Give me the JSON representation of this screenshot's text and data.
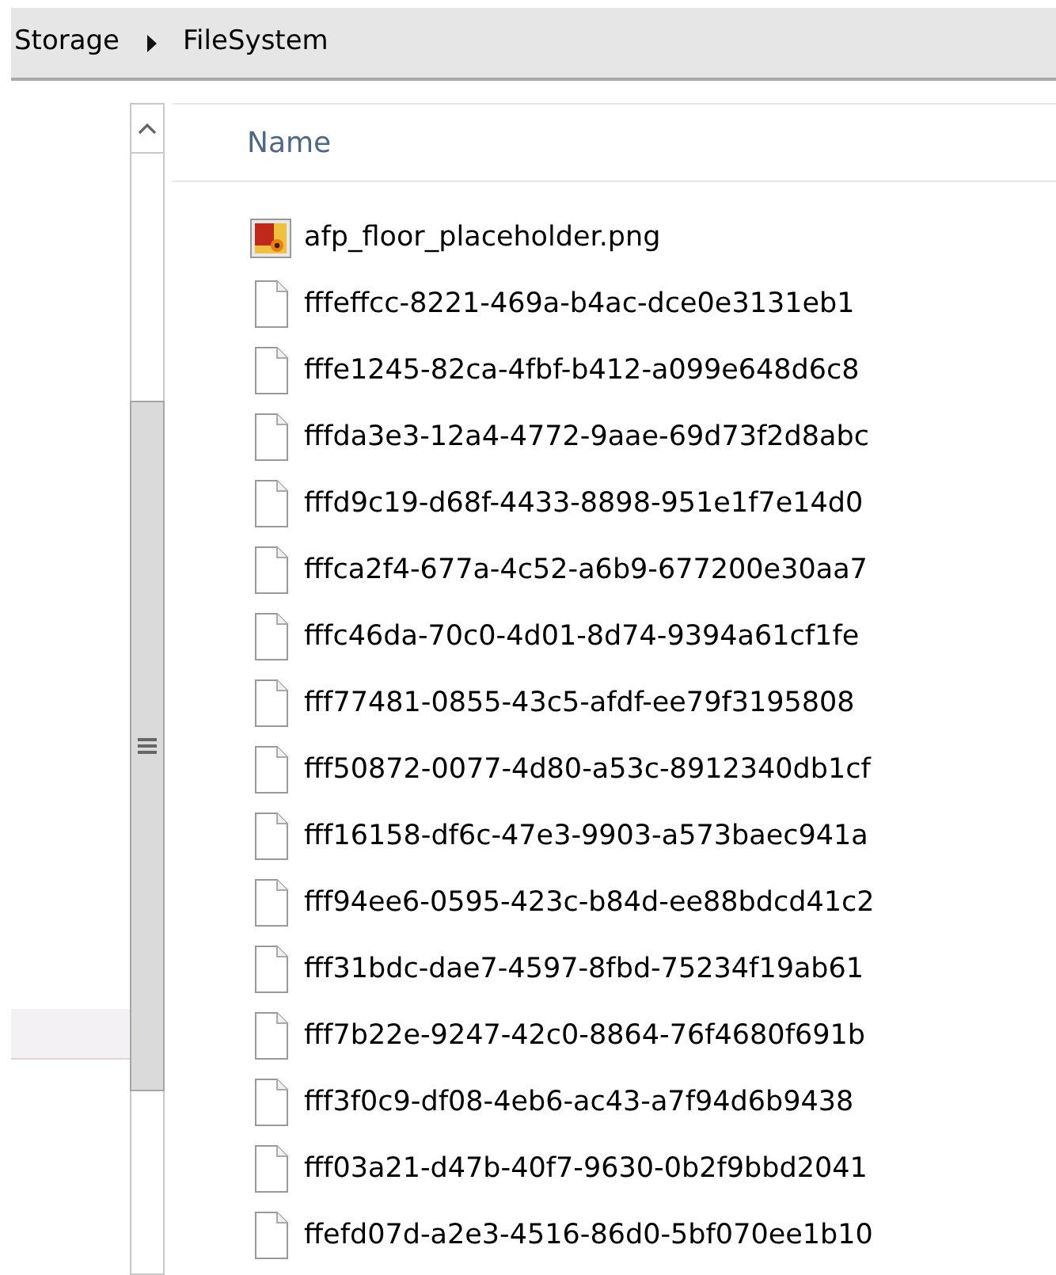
{
  "breadcrumb": [
    "Storage",
    "FileSystem"
  ],
  "columns": [
    {
      "label": "Name"
    }
  ],
  "files": [
    {
      "name": "afp_floor_placeholder.png",
      "kind": "image"
    },
    {
      "name": "fffeffcc-8221-469a-b4ac-dce0e3131eb1",
      "kind": "file"
    },
    {
      "name": "fffe1245-82ca-4fbf-b412-a099e648d6c8",
      "kind": "file"
    },
    {
      "name": "fffda3e3-12a4-4772-9aae-69d73f2d8abc",
      "kind": "file"
    },
    {
      "name": "fffd9c19-d68f-4433-8898-951e1f7e14d0",
      "kind": "file"
    },
    {
      "name": "fffca2f4-677a-4c52-a6b9-677200e30aa7",
      "kind": "file"
    },
    {
      "name": "fffc46da-70c0-4d01-8d74-9394a61cf1fe",
      "kind": "file"
    },
    {
      "name": "fff77481-0855-43c5-afdf-ee79f3195808",
      "kind": "file"
    },
    {
      "name": "fff50872-0077-4d80-a53c-8912340db1cf",
      "kind": "file"
    },
    {
      "name": "fff16158-df6c-47e3-9903-a573baec941a",
      "kind": "file"
    },
    {
      "name": "fff94ee6-0595-423c-b84d-ee88bdcd41c2",
      "kind": "file"
    },
    {
      "name": "fff31bdc-dae7-4597-8fbd-75234f19ab61",
      "kind": "file"
    },
    {
      "name": "fff7b22e-9247-42c0-8864-76f4680f691b",
      "kind": "file"
    },
    {
      "name": "fff3f0c9-df08-4eb6-ac43-a7f94d6b9438",
      "kind": "file"
    },
    {
      "name": "fff03a21-d47b-40f7-9630-0b2f9bbd2041",
      "kind": "file"
    },
    {
      "name": "ffefd07d-a2e3-4516-86d0-5bf070ee1b10",
      "kind": "file"
    }
  ]
}
